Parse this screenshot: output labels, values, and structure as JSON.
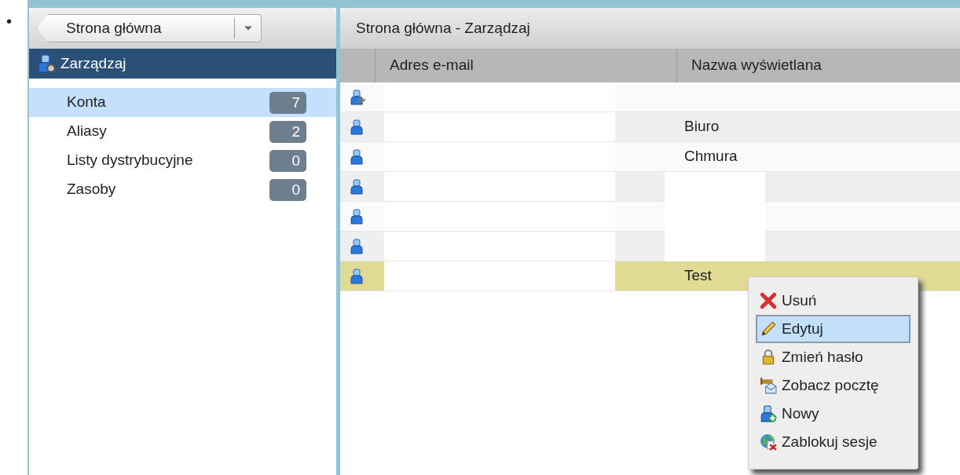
{
  "bullet": "•",
  "sidebar": {
    "breadcrumb": "Strona główna",
    "section": "Zarządzaj",
    "items": [
      {
        "label": "Konta",
        "count": "7",
        "selected": true
      },
      {
        "label": "Aliasy",
        "count": "2",
        "selected": false
      },
      {
        "label": "Listy dystrybucyjne",
        "count": "0",
        "selected": false
      },
      {
        "label": "Zasoby",
        "count": "0",
        "selected": false
      }
    ]
  },
  "main": {
    "title": "Strona główna - Zarządzaj",
    "table": {
      "columns": [
        "Adres e-mail",
        "Nazwa wyświetlana"
      ],
      "rows": [
        {
          "kind": "admin",
          "display_name": "",
          "hidden": false,
          "selected": false
        },
        {
          "kind": "user",
          "display_name": "Biuro",
          "hidden": false,
          "selected": false
        },
        {
          "kind": "user",
          "display_name": "Chmura",
          "hidden": false,
          "selected": false
        },
        {
          "kind": "user",
          "display_name": "",
          "hidden": true,
          "selected": false
        },
        {
          "kind": "user",
          "display_name": "",
          "hidden": true,
          "selected": false
        },
        {
          "kind": "user",
          "display_name": "",
          "hidden": true,
          "selected": false
        },
        {
          "kind": "user",
          "display_name": "Test",
          "hidden": false,
          "selected": true
        }
      ]
    }
  },
  "context_menu": [
    {
      "kind": "delete",
      "label": "Usuń",
      "selected": false
    },
    {
      "kind": "edit",
      "label": "Edytuj",
      "selected": true
    },
    {
      "kind": "lock",
      "label": "Zmień hasło",
      "selected": false
    },
    {
      "kind": "mail",
      "label": "Zobacz pocztę",
      "selected": false
    },
    {
      "kind": "new",
      "label": "Nowy",
      "selected": false
    },
    {
      "kind": "block",
      "label": "Zablokuj sesje",
      "selected": false
    }
  ]
}
